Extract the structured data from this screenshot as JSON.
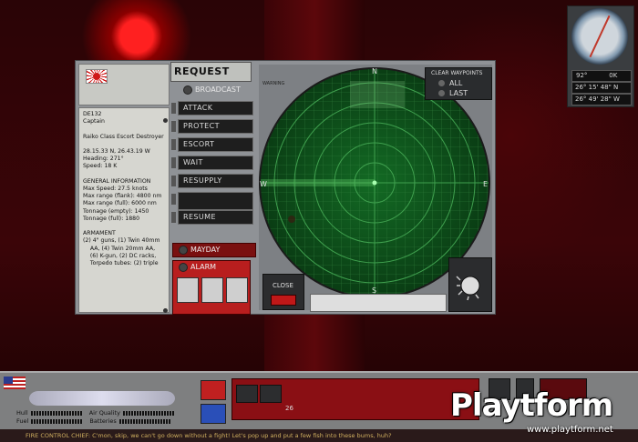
{
  "request": {
    "title": "REQUEST",
    "broadcast": "BROADCAST",
    "commands": [
      "ATTACK",
      "PROTECT",
      "ESCORT",
      "WAIT",
      "RESUPPLY",
      "",
      "RESUME"
    ],
    "mayday": "MAYDAY",
    "alarm": "ALARM"
  },
  "ship_info": {
    "lines": [
      "DE132",
      "Captain",
      "",
      "Raiko Class Escort Destroyer",
      "",
      "28.15.33 N, 26.43.19 W",
      "Heading: 271°",
      "Speed: 18 K",
      "",
      "GENERAL INFORMATION",
      "Max Speed: 27.5 knots",
      "Max range (flank): 4800 nm",
      "Max range (full): 6000 nm",
      "Tonnage (empty): 1450",
      "Tonnage (full): 1880",
      "",
      "ARMAMENT",
      "(2) 4\" guns, (1) Twin 40mm",
      "    AA, (4) Twin 20mm AA,",
      "    (6) K-gun, (2) DC racks,",
      "    Torpedo tubes: (2) triple"
    ]
  },
  "radar": {
    "warning": "WARNING",
    "clear_waypoints": "CLEAR WAYPOINTS",
    "all": "ALL",
    "last": "LAST",
    "close": "CLOSE",
    "north": "N",
    "south": "S",
    "east": "E",
    "west": "W"
  },
  "compass": {
    "heading_value": "92°",
    "heading_suffix": "0K",
    "lat": "26° 15' 48\" N",
    "lon": "26° 49' 28\" W"
  },
  "hud": {
    "hull": "Hull",
    "fuel": "Fuel",
    "air_quality": "Air Quality",
    "batteries": "Batteries",
    "depth_value": "26",
    "ticker": "FIRE CONTROL CHIEF: C'mon, skip, we can't go down without a fight! Let's pop up and put a few fish into these bums, huh?"
  },
  "watermark": {
    "logo": "Playtform",
    "url": "www.playtform.net"
  },
  "colors": {
    "radar_green": "#0d5a1c",
    "alarm_red": "#b81e1e",
    "panel_gray": "#8f9296"
  }
}
